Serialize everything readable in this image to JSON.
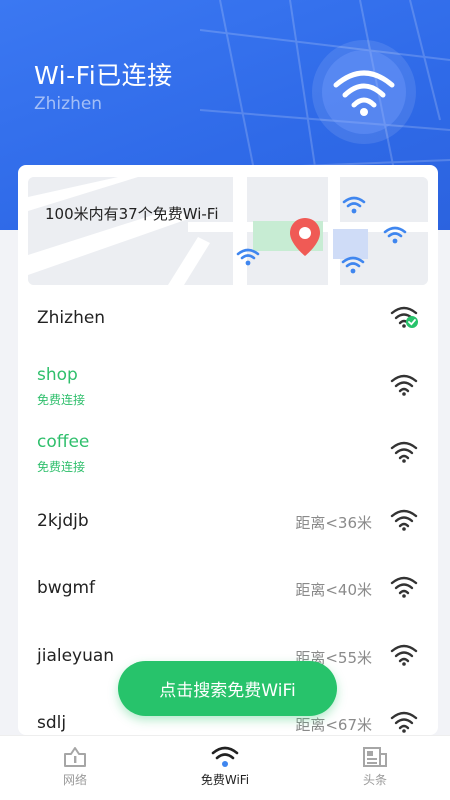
{
  "header": {
    "title": "Wi-Fi已连接",
    "ssid": "Zhizhen",
    "icon": "wifi-icon"
  },
  "map": {
    "caption": "100米内有37个免费Wi-Fi"
  },
  "networks": [
    {
      "name": "Zhizhen",
      "sub": "",
      "distance": "",
      "connected": true
    },
    {
      "name": "shop",
      "sub": "免费连接",
      "distance": "",
      "free": true
    },
    {
      "name": "coffee",
      "sub": "免费连接",
      "distance": "",
      "free": true
    },
    {
      "name": "2kjdjb",
      "sub": "",
      "distance": "距离<36米"
    },
    {
      "name": "bwgmf",
      "sub": "",
      "distance": "距离<40米"
    },
    {
      "name": "jialeyuan",
      "sub": "",
      "distance": "距离<55米"
    },
    {
      "name": "sdlj",
      "sub": "",
      "distance": "距离<67米"
    }
  ],
  "fab": {
    "label": "点击搜索免费WiFi"
  },
  "nav": {
    "items": [
      {
        "label": "网络",
        "icon": "network-icon"
      },
      {
        "label": "免费WiFi",
        "icon": "wifi-icon"
      },
      {
        "label": "头条",
        "icon": "news-icon"
      }
    ]
  },
  "colors": {
    "header": "#2f6ae8",
    "accent_green": "#27c36b",
    "free_text": "#2fbf6c"
  }
}
